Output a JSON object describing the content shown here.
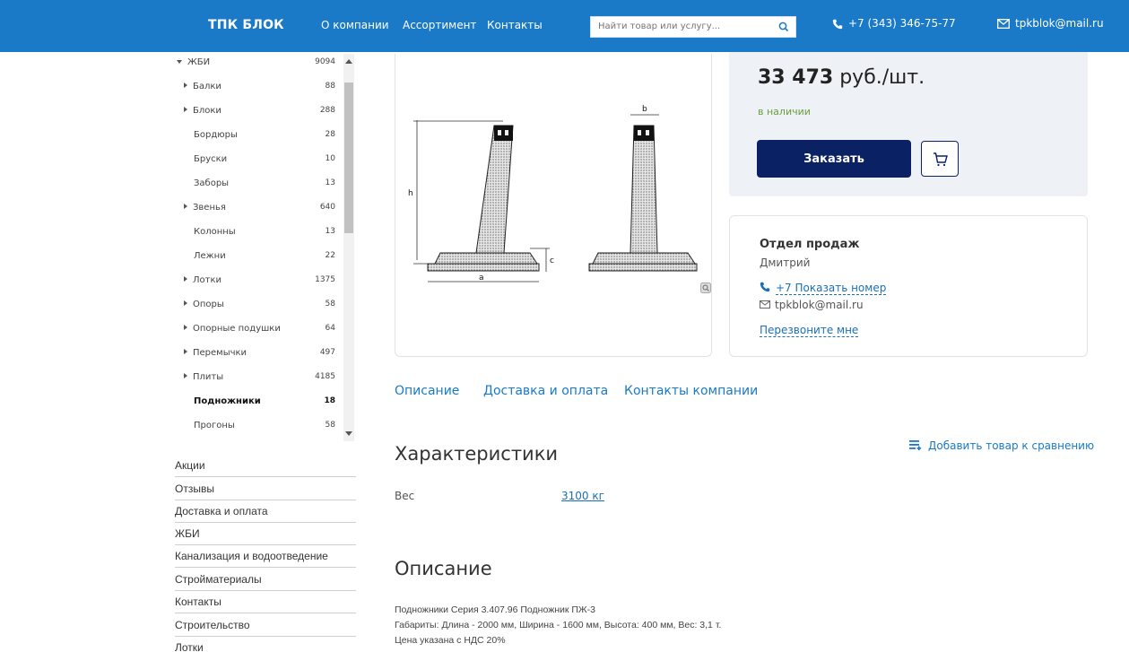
{
  "header": {
    "logo": "ТПК БЛОК",
    "nav": [
      "О компании",
      "Ассортимент",
      "Контакты"
    ],
    "search_placeholder": "Найти товар или услугу...",
    "phone": "+7 (343) 346-75-77",
    "email": "tpkblok@mail.ru",
    "accent_color": "#1a7ac7"
  },
  "catalog_tree": {
    "root": {
      "label": "ЖБИ",
      "count": "9094"
    },
    "items": [
      {
        "label": "Балки",
        "count": "88",
        "expandable": true
      },
      {
        "label": "Блоки",
        "count": "288",
        "expandable": true
      },
      {
        "label": "Бордюры",
        "count": "28",
        "expandable": false
      },
      {
        "label": "Бруски",
        "count": "10",
        "expandable": false
      },
      {
        "label": "Заборы",
        "count": "13",
        "expandable": false
      },
      {
        "label": "Звенья",
        "count": "640",
        "expandable": true
      },
      {
        "label": "Колонны",
        "count": "13",
        "expandable": false
      },
      {
        "label": "Лежни",
        "count": "22",
        "expandable": false
      },
      {
        "label": "Лотки",
        "count": "1375",
        "expandable": true
      },
      {
        "label": "Опоры",
        "count": "58",
        "expandable": true
      },
      {
        "label": "Опорные подушки",
        "count": "64",
        "expandable": true
      },
      {
        "label": "Перемычки",
        "count": "497",
        "expandable": true
      },
      {
        "label": "Плиты",
        "count": "4185",
        "expandable": true
      },
      {
        "label": "Подножники",
        "count": "18",
        "expandable": false,
        "active": true
      },
      {
        "label": "Прогоны",
        "count": "58",
        "expandable": false
      }
    ]
  },
  "side_menu": [
    "Акции",
    "Отзывы",
    "Доставка и оплата",
    "ЖБИ",
    "Канализация и водоотведение",
    "Стройматериалы",
    "Контакты",
    "Строительство",
    "Лотки"
  ],
  "drawing": {
    "labels": [
      "h",
      "a",
      "c",
      "b"
    ]
  },
  "product": {
    "price_value": "33 473",
    "price_unit": "руб./шт.",
    "stock": "в наличии",
    "order_button": "Заказать"
  },
  "contacts": {
    "department": "Отдел продаж",
    "person": "Дмитрий",
    "phone_link": "+7 Показать номер",
    "email": "tpkblok@mail.ru",
    "callback": "Перезвоните мне"
  },
  "tabs": [
    "Описание",
    "Доставка и оплата",
    "Контакты компании"
  ],
  "specs": {
    "title": "Характеристики",
    "compare_link": "Добавить товар к сравнению",
    "rows": [
      {
        "name": "Вес",
        "value": "3100 кг"
      }
    ]
  },
  "description": {
    "title": "Описание",
    "lines": [
      "Подножники Серия 3.407.96 Подножник ПЖ-3",
      "Габариты: Длина - 2000 мм, Ширина - 1600 мм, Высота: 400 мм, Вес: 3,1 т.",
      "Цена указана с НДС 20%"
    ]
  }
}
